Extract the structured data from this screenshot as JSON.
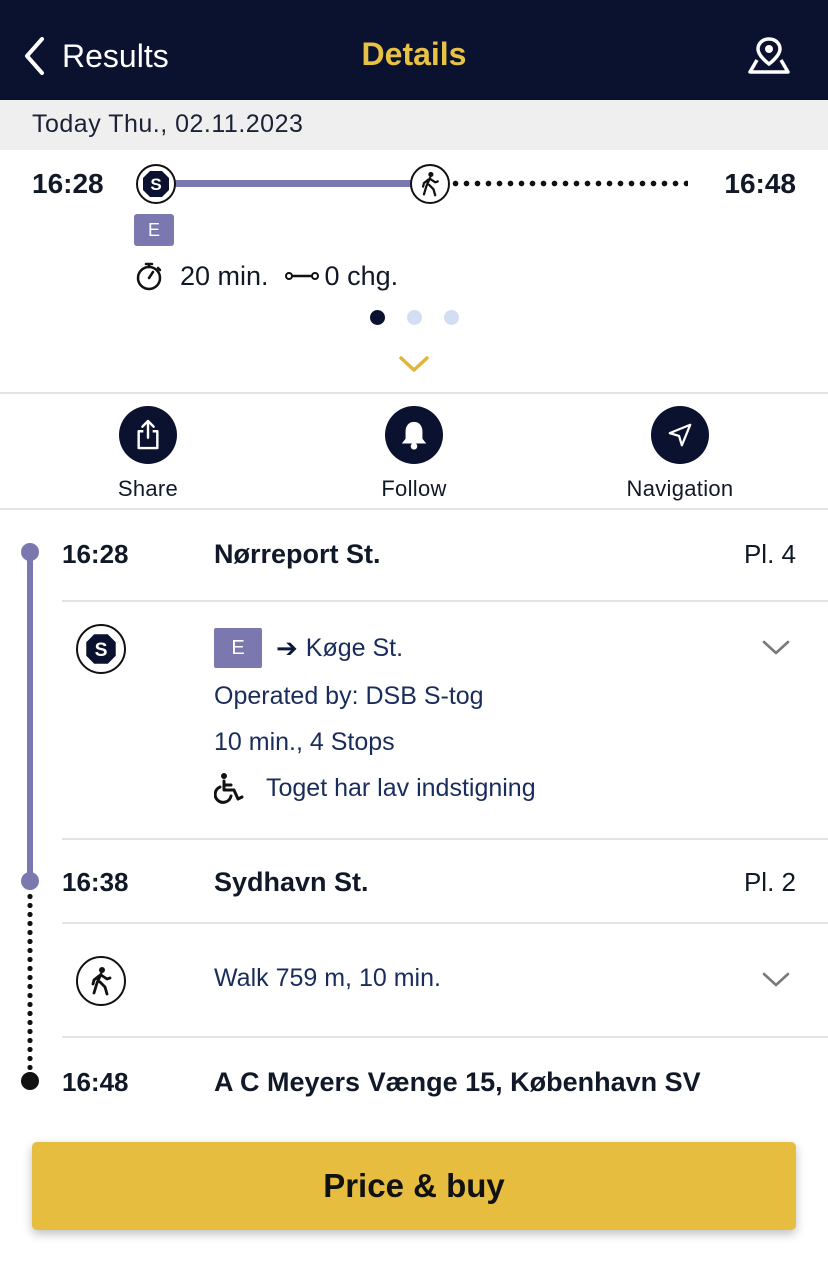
{
  "header": {
    "back_label": "Results",
    "title": "Details",
    "map_icon": "map-pin-icon"
  },
  "date_bar": {
    "text": "Today Thu., 02.11.2023"
  },
  "summary": {
    "departure_time": "16:28",
    "arrival_time": "16:48",
    "line": "E",
    "duration": "20 min.",
    "changes": "0 chg.",
    "pager": {
      "total": 3,
      "active": 1
    }
  },
  "actions": {
    "share_label": "Share",
    "follow_label": "Follow",
    "navigation_label": "Navigation"
  },
  "itinerary": {
    "stops": [
      {
        "time": "16:28",
        "name": "Nørreport St.",
        "platform": "Pl. 4"
      },
      {
        "time": "16:38",
        "name": "Sydhavn St.",
        "platform": "Pl. 2"
      },
      {
        "time": "16:48",
        "name": "A C Meyers Vænge 15, København SV",
        "platform": ""
      }
    ],
    "train_leg": {
      "line": "E",
      "arrow": "➔",
      "direction": "Køge St.",
      "operator": "Operated by: DSB S-tog",
      "duration_stops": "10 min., 4 Stops",
      "accessibility": "Toget har lav indstigning"
    },
    "walk_leg": {
      "text": "Walk 759 m, 10 min."
    }
  },
  "buy_button": {
    "label": "Price & buy"
  },
  "colors": {
    "header_bg": "#0a1230",
    "header_title": "#e8c244",
    "line_purple": "#7b78b0",
    "buy_button": "#e6bd3f"
  }
}
